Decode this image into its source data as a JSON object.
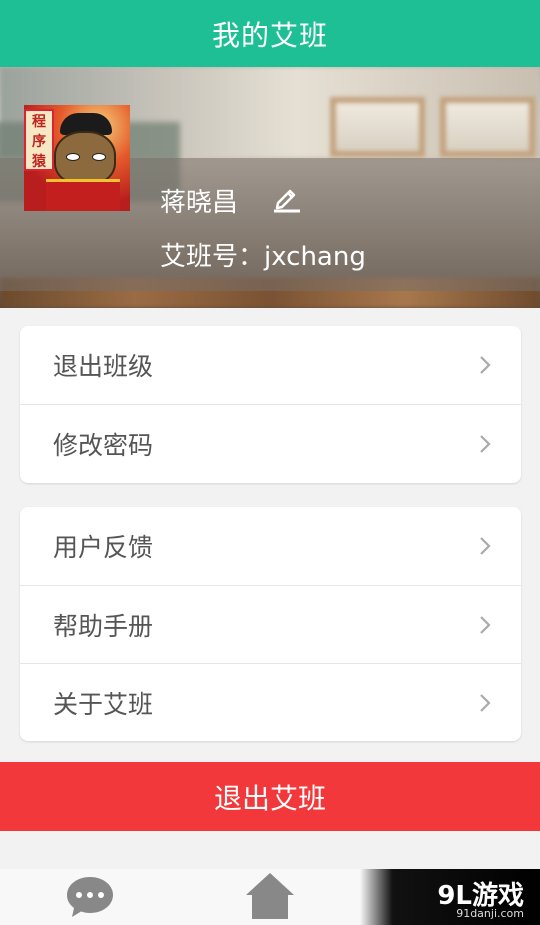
{
  "header": {
    "title": "我的艾班"
  },
  "profile": {
    "name": "蒋晓昌",
    "account": "艾班号：jxchang",
    "avatar_text": "程序猿"
  },
  "group1": [
    {
      "label": "退出班级"
    },
    {
      "label": "修改密码"
    }
  ],
  "group2": [
    {
      "label": "用户反馈"
    },
    {
      "label": "帮助手册"
    },
    {
      "label": "关于艾班"
    }
  ],
  "logout_button": "退出艾班",
  "bottom_nav": {
    "items": [
      {
        "icon": "chat-bubble-icon"
      },
      {
        "icon": "home-icon"
      }
    ]
  },
  "watermark": {
    "logo": "9L游戏",
    "url": "91danji.com"
  },
  "colors": {
    "header": "#1fbf95",
    "logout": "#f2383b",
    "text_row": "#555555"
  }
}
